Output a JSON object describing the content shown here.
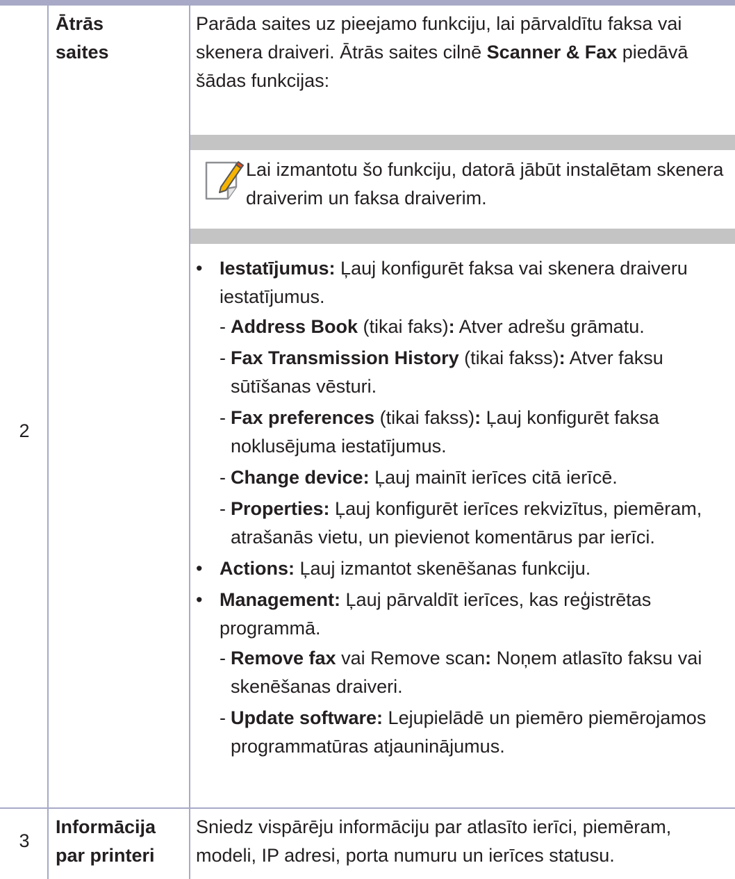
{
  "rows": [
    {
      "number": "2",
      "feature_line1": "Ātrās",
      "feature_line2": "saites",
      "description_intro_a": "Parāda saites uz pieejamo funkciju, lai pārvaldītu faksa vai skenera draiveri. Ātrās saites cilnē ",
      "description_intro_bold": "Scanner & Fax",
      "description_intro_b": " piedāvā šādas funkcijas:",
      "note": "Lai izmantotu šo funkciju, datorā jābūt instalētam skenera draiverim un faksa draiverim.",
      "bullets": [
        {
          "label": "Iestatījumus:",
          "text": " Ļauj konfigurēt faksa vai skenera draiveru iestatījumus.",
          "sub": [
            {
              "label": "Address Book",
              "mid": " (tikai faks)",
              "colon": ":",
              "text": " Atver adrešu grāmatu."
            },
            {
              "label": "Fax Transmission History",
              "mid": " (tikai fakss)",
              "colon": ":",
              "text": " Atver faksu sūtīšanas vēsturi."
            },
            {
              "label": "Fax preferences",
              "mid": " (tikai fakss)",
              "colon": ":",
              "text": " Ļauj konfigurēt faksa noklusējuma iestatījumus."
            },
            {
              "label": "Change device:",
              "mid": "",
              "colon": "",
              "text": " Ļauj mainīt ierīces citā ierīcē."
            },
            {
              "label": "Properties:",
              "mid": "",
              "colon": "",
              "text": " Ļauj konfigurēt ierīces rekvizītus, piemēram, atrašanās vietu, un pievienot komentārus par ierīci."
            }
          ]
        },
        {
          "label": "Actions:",
          "text": " Ļauj izmantot skenēšanas funkciju.",
          "sub": []
        },
        {
          "label": "Management:",
          "text": " Ļauj pārvaldīt ierīces, kas reģistrētas programmā.",
          "sub": [
            {
              "label": "Remove fax",
              "mid": " vai Remove scan",
              "colon": ":",
              "text": " Noņem atlasīto faksu vai skenēšanas draiveri."
            },
            {
              "label": "Update software:",
              "mid": "",
              "colon": "",
              "text": " Lejupielādē un piemēro piemērojamos programmatūras atjauninājumus."
            }
          ]
        }
      ]
    },
    {
      "number": "3",
      "feature_line1": "Informācija",
      "feature_line2": "par printeri",
      "description": "Sniedz vispārēju informāciju par atlasīto ierīci, piemēram, modeli, IP adresi, porta numuru un ierīces statusu."
    }
  ],
  "colors": {
    "rule": "#a7a9c6",
    "note_band": "#c4c4c4",
    "text": "#231f20",
    "note_icon": "#f6b400"
  },
  "icons": {
    "note": "pencil-note-icon"
  }
}
